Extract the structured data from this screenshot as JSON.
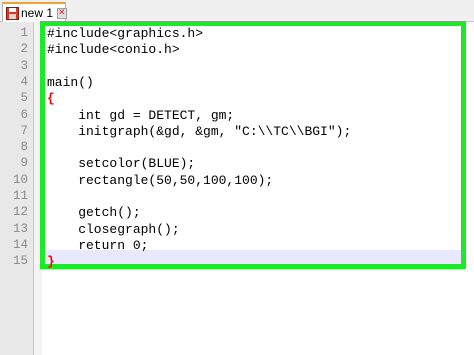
{
  "tab": {
    "label": "new 1",
    "close_symbol": "✕",
    "icon": "save-disk-icon"
  },
  "editor": {
    "line_numbers": [
      "1",
      "2",
      "3",
      "4",
      "5",
      "6",
      "7",
      "8",
      "9",
      "10",
      "11",
      "12",
      "13",
      "14",
      "15"
    ],
    "lines": [
      "#include<graphics.h>",
      "#include<conio.h>",
      "",
      "main()",
      "{",
      "    int gd = DETECT, gm;",
      "    initgraph(&gd, &gm, \"C:\\\\TC\\\\BGI\");",
      "",
      "    setcolor(BLUE);",
      "    rectangle(50,50,100,100);",
      "",
      "    getch();",
      "    closegraph();",
      "    return 0;",
      "}"
    ]
  },
  "colors": {
    "highlight_border": "#1ee82a",
    "brace": "#ff0000",
    "tab_accent": "#f3a13b"
  }
}
